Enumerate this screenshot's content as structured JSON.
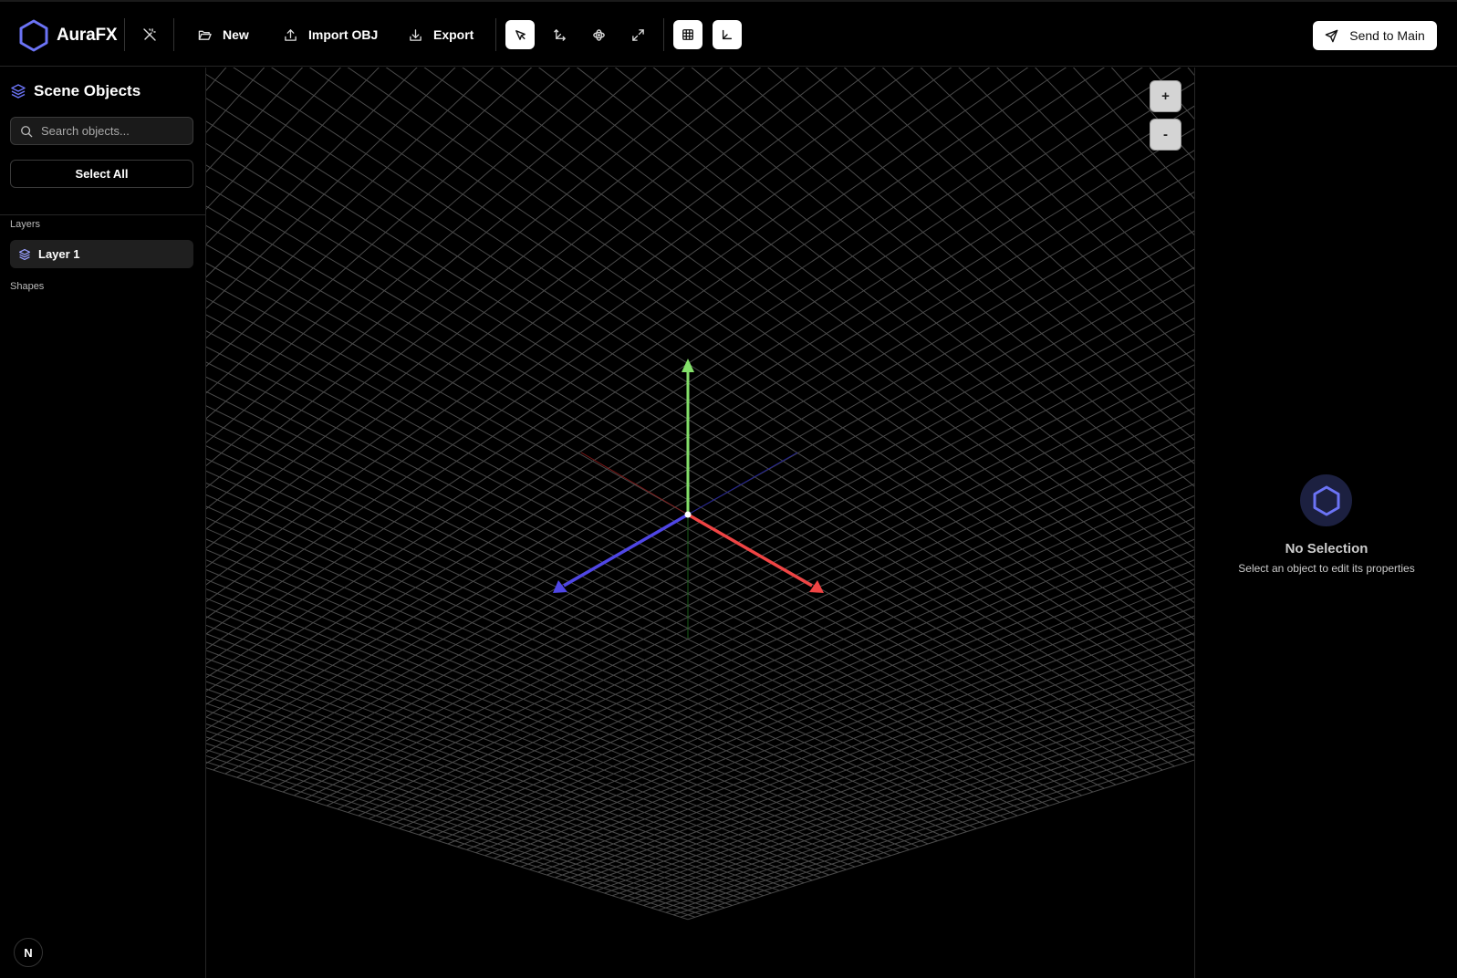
{
  "app": {
    "name": "AuraFX"
  },
  "toolbar": {
    "new_label": "New",
    "import_label": "Import OBJ",
    "export_label": "Export",
    "send_label": "Send to Main",
    "tools": [
      "select-cursor-icon",
      "move-axes-icon",
      "rotate-icon",
      "scale-expand-icon",
      "grid-icon",
      "axis-corner-icon"
    ]
  },
  "sidebar": {
    "title": "Scene Objects",
    "search_placeholder": "Search objects...",
    "select_all_label": "Select All",
    "layers_label": "Layers",
    "layers": [
      {
        "label": "Layer 1"
      }
    ],
    "shapes_label": "Shapes",
    "badge": "N"
  },
  "viewport": {
    "zoom_in_label": "+",
    "zoom_out_label": "-",
    "axis_colors": {
      "x": "#ef4444",
      "y": "#84e06a",
      "z": "#4f46e5"
    },
    "grid_color": "#4a4a4a"
  },
  "properties": {
    "empty_title": "No Selection",
    "empty_subtitle": "Select an object to edit its properties"
  },
  "colors": {
    "accent": "#6b73f5",
    "background": "#000000"
  }
}
